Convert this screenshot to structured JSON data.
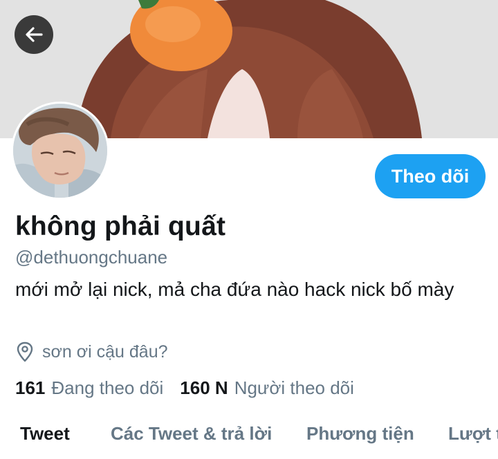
{
  "profile": {
    "display_name": "không phải quất",
    "handle": "@dethuongchuane",
    "bio": "mới mở lại nick, mả cha đứa nào hack nick bố mày",
    "location": "sơn ơi cậu đâu?",
    "follow_label": "Theo dõi"
  },
  "stats": {
    "following_count": "161",
    "following_label": "Đang theo dõi",
    "followers_count": "160 N",
    "followers_label": "Người theo dõi"
  },
  "tabs": [
    {
      "label": "Tweet",
      "active": true
    },
    {
      "label": "Các Tweet & trả lời",
      "active": false
    },
    {
      "label": "Phương tiện",
      "active": false
    },
    {
      "label": "Lượt thích",
      "active": false
    }
  ],
  "icons": {
    "back": "arrow-left-icon",
    "location": "location-pin-icon"
  },
  "colors": {
    "accent": "#1da1f2",
    "secondary_text": "#657786",
    "primary_text": "#14171a"
  }
}
